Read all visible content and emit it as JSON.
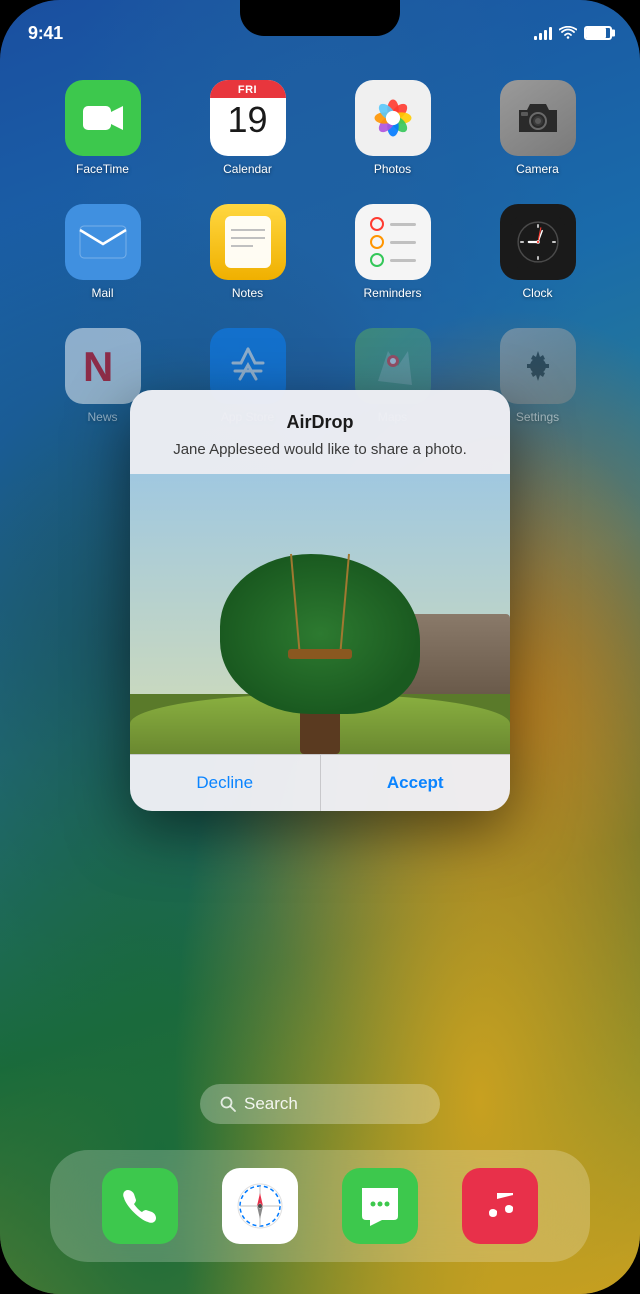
{
  "phone": {
    "status_bar": {
      "time": "9:41",
      "signal_strength": 4,
      "wifi": true,
      "battery_percent": 85
    },
    "wallpaper": "ios-gradient-blue-green-gold"
  },
  "apps": {
    "row1": [
      {
        "id": "facetime",
        "label": "FaceTime",
        "bg": "#3dc84d"
      },
      {
        "id": "calendar",
        "label": "Calendar",
        "day_abbr": "FRI",
        "date": "19"
      },
      {
        "id": "photos",
        "label": "Photos"
      },
      {
        "id": "camera",
        "label": "Camera",
        "bg": "#9a9a9a"
      }
    ],
    "row2": [
      {
        "id": "mail",
        "label": "Mail",
        "bg": "#4090e0"
      },
      {
        "id": "notes",
        "label": "Notes",
        "bg": "#ffd740"
      },
      {
        "id": "reminders",
        "label": "Reminders",
        "bg": "#f5f5f5"
      },
      {
        "id": "clock",
        "label": "Clock",
        "bg": "#1a1a1a"
      }
    ],
    "row3": [
      {
        "id": "news",
        "label": "News",
        "bg": "#f5f5f5"
      },
      {
        "id": "appstore",
        "label": "App Store",
        "bg": "#0a84ff"
      },
      {
        "id": "maps",
        "label": "Maps",
        "bg": "#5aad5a"
      },
      {
        "id": "settings",
        "label": "Settings",
        "bg": "#b0b0b0"
      }
    ]
  },
  "airdrop_modal": {
    "title": "AirDrop",
    "message": "Jane Appleseed would like to share a photo.",
    "decline_label": "Decline",
    "accept_label": "Accept"
  },
  "search": {
    "placeholder": "Search",
    "icon": "search"
  },
  "dock": {
    "apps": [
      {
        "id": "phone",
        "label": "Phone",
        "bg": "#3dc84d"
      },
      {
        "id": "safari",
        "label": "Safari",
        "bg": "#ffffff"
      },
      {
        "id": "messages",
        "label": "Messages",
        "bg": "#3dc84d"
      },
      {
        "id": "music",
        "label": "Music",
        "bg": "#e8304a"
      }
    ]
  }
}
